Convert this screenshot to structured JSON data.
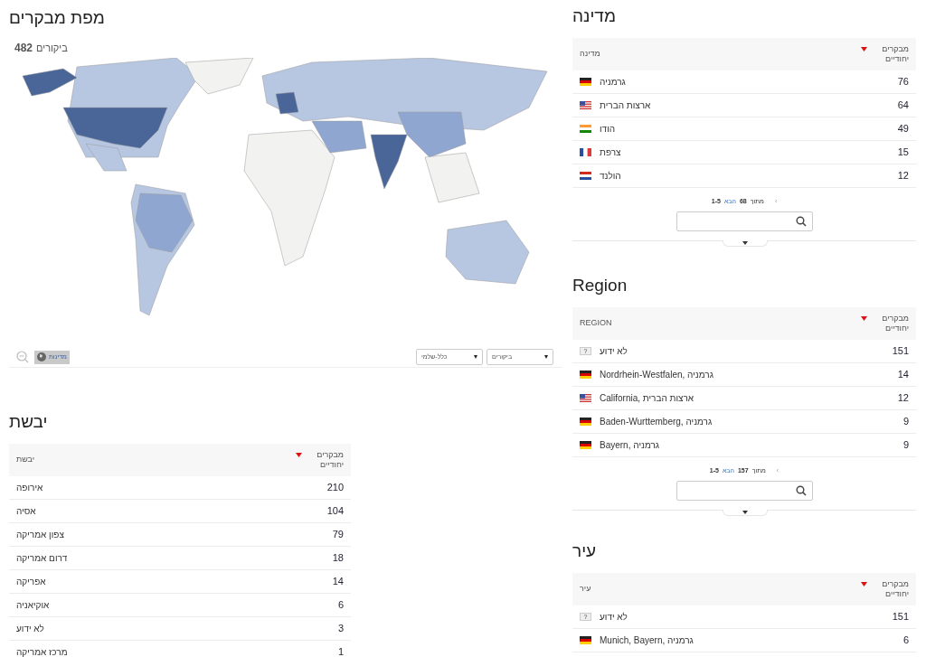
{
  "map": {
    "title": "מפת מבקרים",
    "visits_count": "482",
    "visits_label": "ביקורים",
    "zoom_button": "מדינות",
    "dropdowns": [
      {
        "value": "ביקורים",
        "caret": "▾"
      },
      {
        "value": "כלל-שלמי",
        "caret": "▾"
      }
    ]
  },
  "continents": {
    "title": "יבשת",
    "column_label": "יבשת",
    "metric_label": "מבקרים יחודיים",
    "rows": [
      {
        "label": "אירופה",
        "value": "210"
      },
      {
        "label": "אסיה",
        "value": "104"
      },
      {
        "label": "צפון אמריקה",
        "value": "79"
      },
      {
        "label": "דרום אמריקה",
        "value": "18"
      },
      {
        "label": "אפריקה",
        "value": "14"
      },
      {
        "label": "אוקיאניה",
        "value": "6"
      },
      {
        "label": "לא ידוע",
        "value": "3"
      },
      {
        "label": "מרכז אמריקה",
        "value": "1"
      }
    ]
  },
  "countries": {
    "title": "מדינה",
    "column_label": "מדינה",
    "metric_label": "מבקרים יחודיים",
    "rows": [
      {
        "kind": "de",
        "label": "גרמניה",
        "value": "76"
      },
      {
        "kind": "us",
        "label": "ארצות הברית",
        "value": "64"
      },
      {
        "kind": "in",
        "label": "הודו",
        "value": "49"
      },
      {
        "kind": "fr",
        "label": "צרפת",
        "value": "15"
      },
      {
        "kind": "nl",
        "label": "הולנד",
        "value": "12"
      }
    ],
    "pagination": {
      "range": "1-5",
      "next": "הבא",
      "total": "68",
      "of": "מתוך",
      "prev": "‹"
    }
  },
  "regions": {
    "title": "Region",
    "column_label": "REGION",
    "metric_label": "מבקרים יחודיים",
    "rows": [
      {
        "kind": "unknown",
        "badge": "?",
        "label": "לא ידוע",
        "value": "151"
      },
      {
        "kind": "de",
        "label": "Nordrhein-Westfalen, גרמניה",
        "value": "14"
      },
      {
        "kind": "us",
        "label": "California, ארצות הברית",
        "value": "12"
      },
      {
        "kind": "de",
        "label": "Baden-Wurttemberg, גרמניה",
        "value": "9"
      },
      {
        "kind": "de",
        "label": "Bayern, גרמניה",
        "value": "9"
      }
    ],
    "pagination": {
      "range": "1-5",
      "next": "הבא",
      "total": "157",
      "of": "מתוך",
      "prev": "‹"
    }
  },
  "cities": {
    "title": "עיר",
    "column_label": "עיר",
    "metric_label": "מבקרים יחודיים",
    "rows": [
      {
        "kind": "unknown",
        "badge": "?",
        "label": "לא ידוע",
        "value": "151"
      },
      {
        "kind": "de",
        "label": "Munich, Bayern, גרמניה",
        "value": "6"
      }
    ]
  }
}
